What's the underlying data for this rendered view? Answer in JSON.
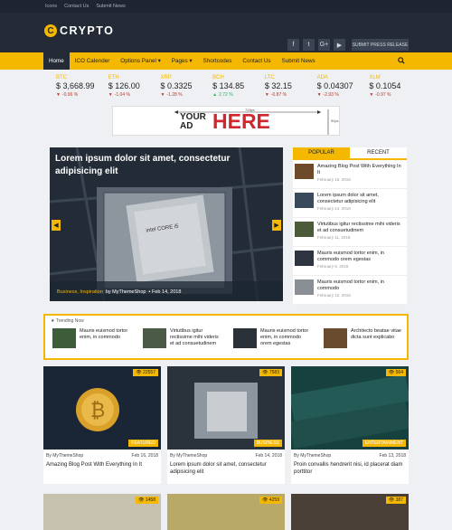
{
  "topbar": {
    "links": [
      "Icons",
      "Contact Us",
      "Submit News"
    ]
  },
  "header": {
    "logo": "CRYPTO",
    "social": [
      "f",
      "t",
      "G+",
      "▶"
    ],
    "press_button": "SUBMIT PRESS RELEASE"
  },
  "nav": {
    "items": [
      "Home",
      "ICO Calender",
      "Options Panel ▾",
      "Pages ▾",
      "Shortcodes",
      "Contact Us",
      "Submit News"
    ]
  },
  "ticker": [
    {
      "symbol": "BTC",
      "price": "$ 3,668.99",
      "change": "-0.96 %",
      "dir": "down"
    },
    {
      "symbol": "ETH",
      "price": "$ 126.00",
      "change": "-1.04 %",
      "dir": "down"
    },
    {
      "symbol": "XRP",
      "price": "$ 0.3325",
      "change": "-1.28 %",
      "dir": "down"
    },
    {
      "symbol": "BCH",
      "price": "$ 134.85",
      "change": "2.72 %",
      "dir": "up"
    },
    {
      "symbol": "LTC",
      "price": "$ 32.15",
      "change": "-0.87 %",
      "dir": "down"
    },
    {
      "symbol": "ADA",
      "price": "$ 0.04307",
      "change": "-2.93 %",
      "dir": "down"
    },
    {
      "symbol": "XLM",
      "price": "$ 0.1054",
      "change": "-0.97 %",
      "dir": "down"
    }
  ],
  "ad": {
    "line1": "YOUR",
    "line2": "AD",
    "highlight": "HERE",
    "width_label": "728px",
    "height_label": "90px"
  },
  "slider": {
    "title": "Lorem ipsum dolor sit amet, consectetur adipisicing elit",
    "categories": "Business, Inspiration",
    "author": "by MyThemeShop",
    "date": "Feb 14, 2018"
  },
  "tabs": {
    "popular": "POPULAR",
    "recent": "RECENT",
    "items": [
      {
        "title": "Amazing Blog Post With Everything In It",
        "date": "February 16, 2018"
      },
      {
        "title": "Lorem ipsum dolor sit amet, consectetur adipisicing elit",
        "date": "February 14, 2018"
      },
      {
        "title": "Virtutibus igitur rectissime mihi videris et ad consuetudinem",
        "date": "February 11, 2018"
      },
      {
        "title": "Mauris euismod tortor enim, in commodo orem egestas",
        "date": "February 9, 2018"
      },
      {
        "title": "Mauris euismod tortor enim, in commodo",
        "date": "February 12, 2018"
      }
    ]
  },
  "trending": {
    "label": "Trending Now",
    "items": [
      {
        "title": "Mauris euismod tortor enim, in commodo"
      },
      {
        "title": "Virtutibus igitur rectissime mihi videris et ad consuetudinem"
      },
      {
        "title": "Mauris euismod tortor enim, in commodo orem egestas"
      },
      {
        "title": "Architecto beatae vitae dicta sunt explicabo"
      }
    ]
  },
  "cards": [
    {
      "views": "22557",
      "category": "FEATURED",
      "author": "By MyThemeShop",
      "date": "Feb 16, 2018",
      "title": "Amazing Blog Post With Everything In It"
    },
    {
      "views": "7583",
      "category": "BUSINESS",
      "author": "By MyThemeShop",
      "date": "Feb 14, 2018",
      "title": "Lorem ipsum dolor sit amet, consectetur adipisicing elit"
    },
    {
      "views": "564",
      "category": "ENTERTAINMENT",
      "author": "By MyThemeShop",
      "date": "Feb 13, 2018",
      "title": "Proin convallis hendrerit nisi, id placerat diam porttitor"
    }
  ],
  "cards_row2": [
    {
      "views": "1458"
    },
    {
      "views": "4259"
    },
    {
      "views": "387"
    }
  ]
}
